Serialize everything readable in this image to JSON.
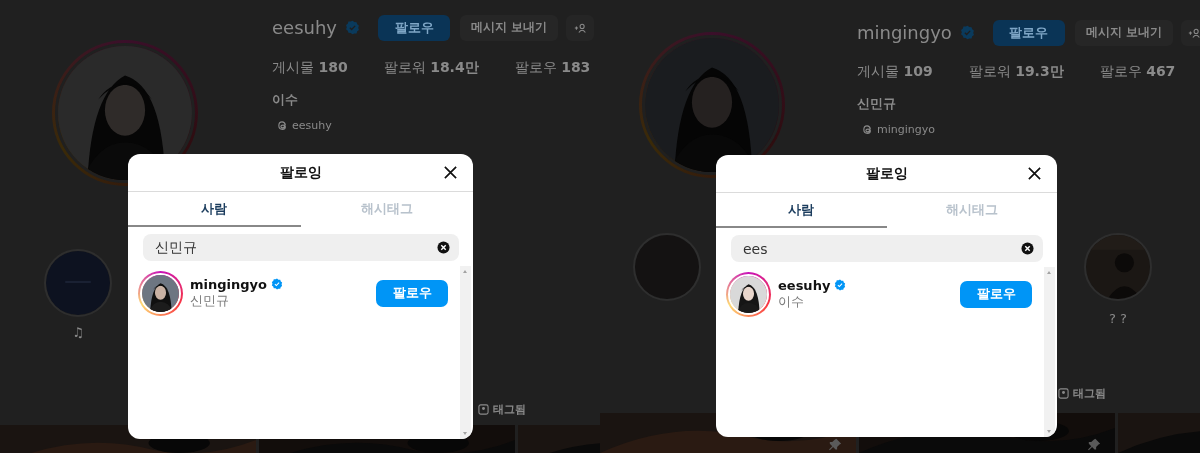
{
  "profiles": [
    {
      "username": "eesuhy",
      "verified": true,
      "follow_button": "팔로우",
      "message_button": "메시지 보내기",
      "stats": [
        {
          "label": "게시물",
          "value": "180"
        },
        {
          "label": "팔로워",
          "value": "18.4만"
        },
        {
          "label": "팔로우",
          "value": "183"
        }
      ],
      "name": "이수",
      "threads": "eesuhy",
      "highlights": [
        {
          "kind": "highlight",
          "label": "♫"
        }
      ],
      "tagged_tab": "태그됨",
      "modal": {
        "title": "팔로잉",
        "tabs": [
          {
            "label": "사람",
            "selected": true
          },
          {
            "label": "해시태그",
            "selected": false
          }
        ],
        "search": {
          "value": "신민규"
        },
        "results": [
          {
            "username": "mingingyo",
            "verified": true,
            "name": "신민규",
            "button": "팔로우"
          }
        ]
      }
    },
    {
      "username": "mingingyo",
      "verified": true,
      "follow_button": "팔로우",
      "message_button": "메시지 보내기",
      "stats": [
        {
          "label": "게시물",
          "value": "109"
        },
        {
          "label": "팔로워",
          "value": "19.3만"
        },
        {
          "label": "팔로우",
          "value": "467"
        }
      ],
      "name": "신민규",
      "threads": "mingingyo",
      "highlights": [
        {
          "kind": "highlight"
        },
        {
          "kind": "highlight",
          "label": "? ?"
        }
      ],
      "tagged_tab": "태그됨",
      "modal": {
        "title": "팔로잉",
        "tabs": [
          {
            "label": "사람",
            "selected": true
          },
          {
            "label": "해시태그",
            "selected": false
          }
        ],
        "search": {
          "value": "ees"
        },
        "results": [
          {
            "username": "eesuhy",
            "verified": true,
            "name": "이수",
            "button": "팔로우"
          }
        ]
      }
    }
  ]
}
